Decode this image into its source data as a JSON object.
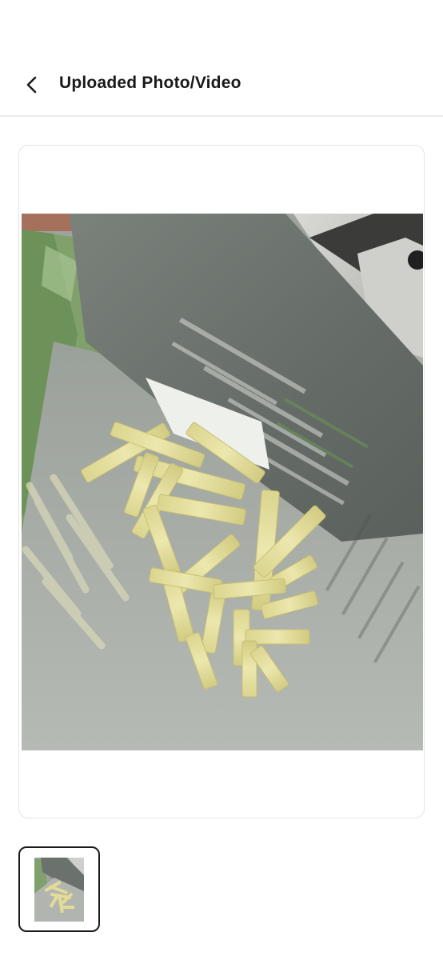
{
  "header": {
    "title": "Uploaded Photo/Video",
    "back_icon": "chevron-left-icon"
  },
  "main": {
    "photo_subject": "photo-of-fries-in-bag",
    "thumbnails": [
      {
        "selected": true,
        "icon": "photo-thumbnail"
      }
    ]
  },
  "colors": {
    "title_text": "#1a1a1a",
    "divider": "#ececec",
    "card_border": "#e4e4e4",
    "thumb_border_selected": "#1a1a1a"
  }
}
